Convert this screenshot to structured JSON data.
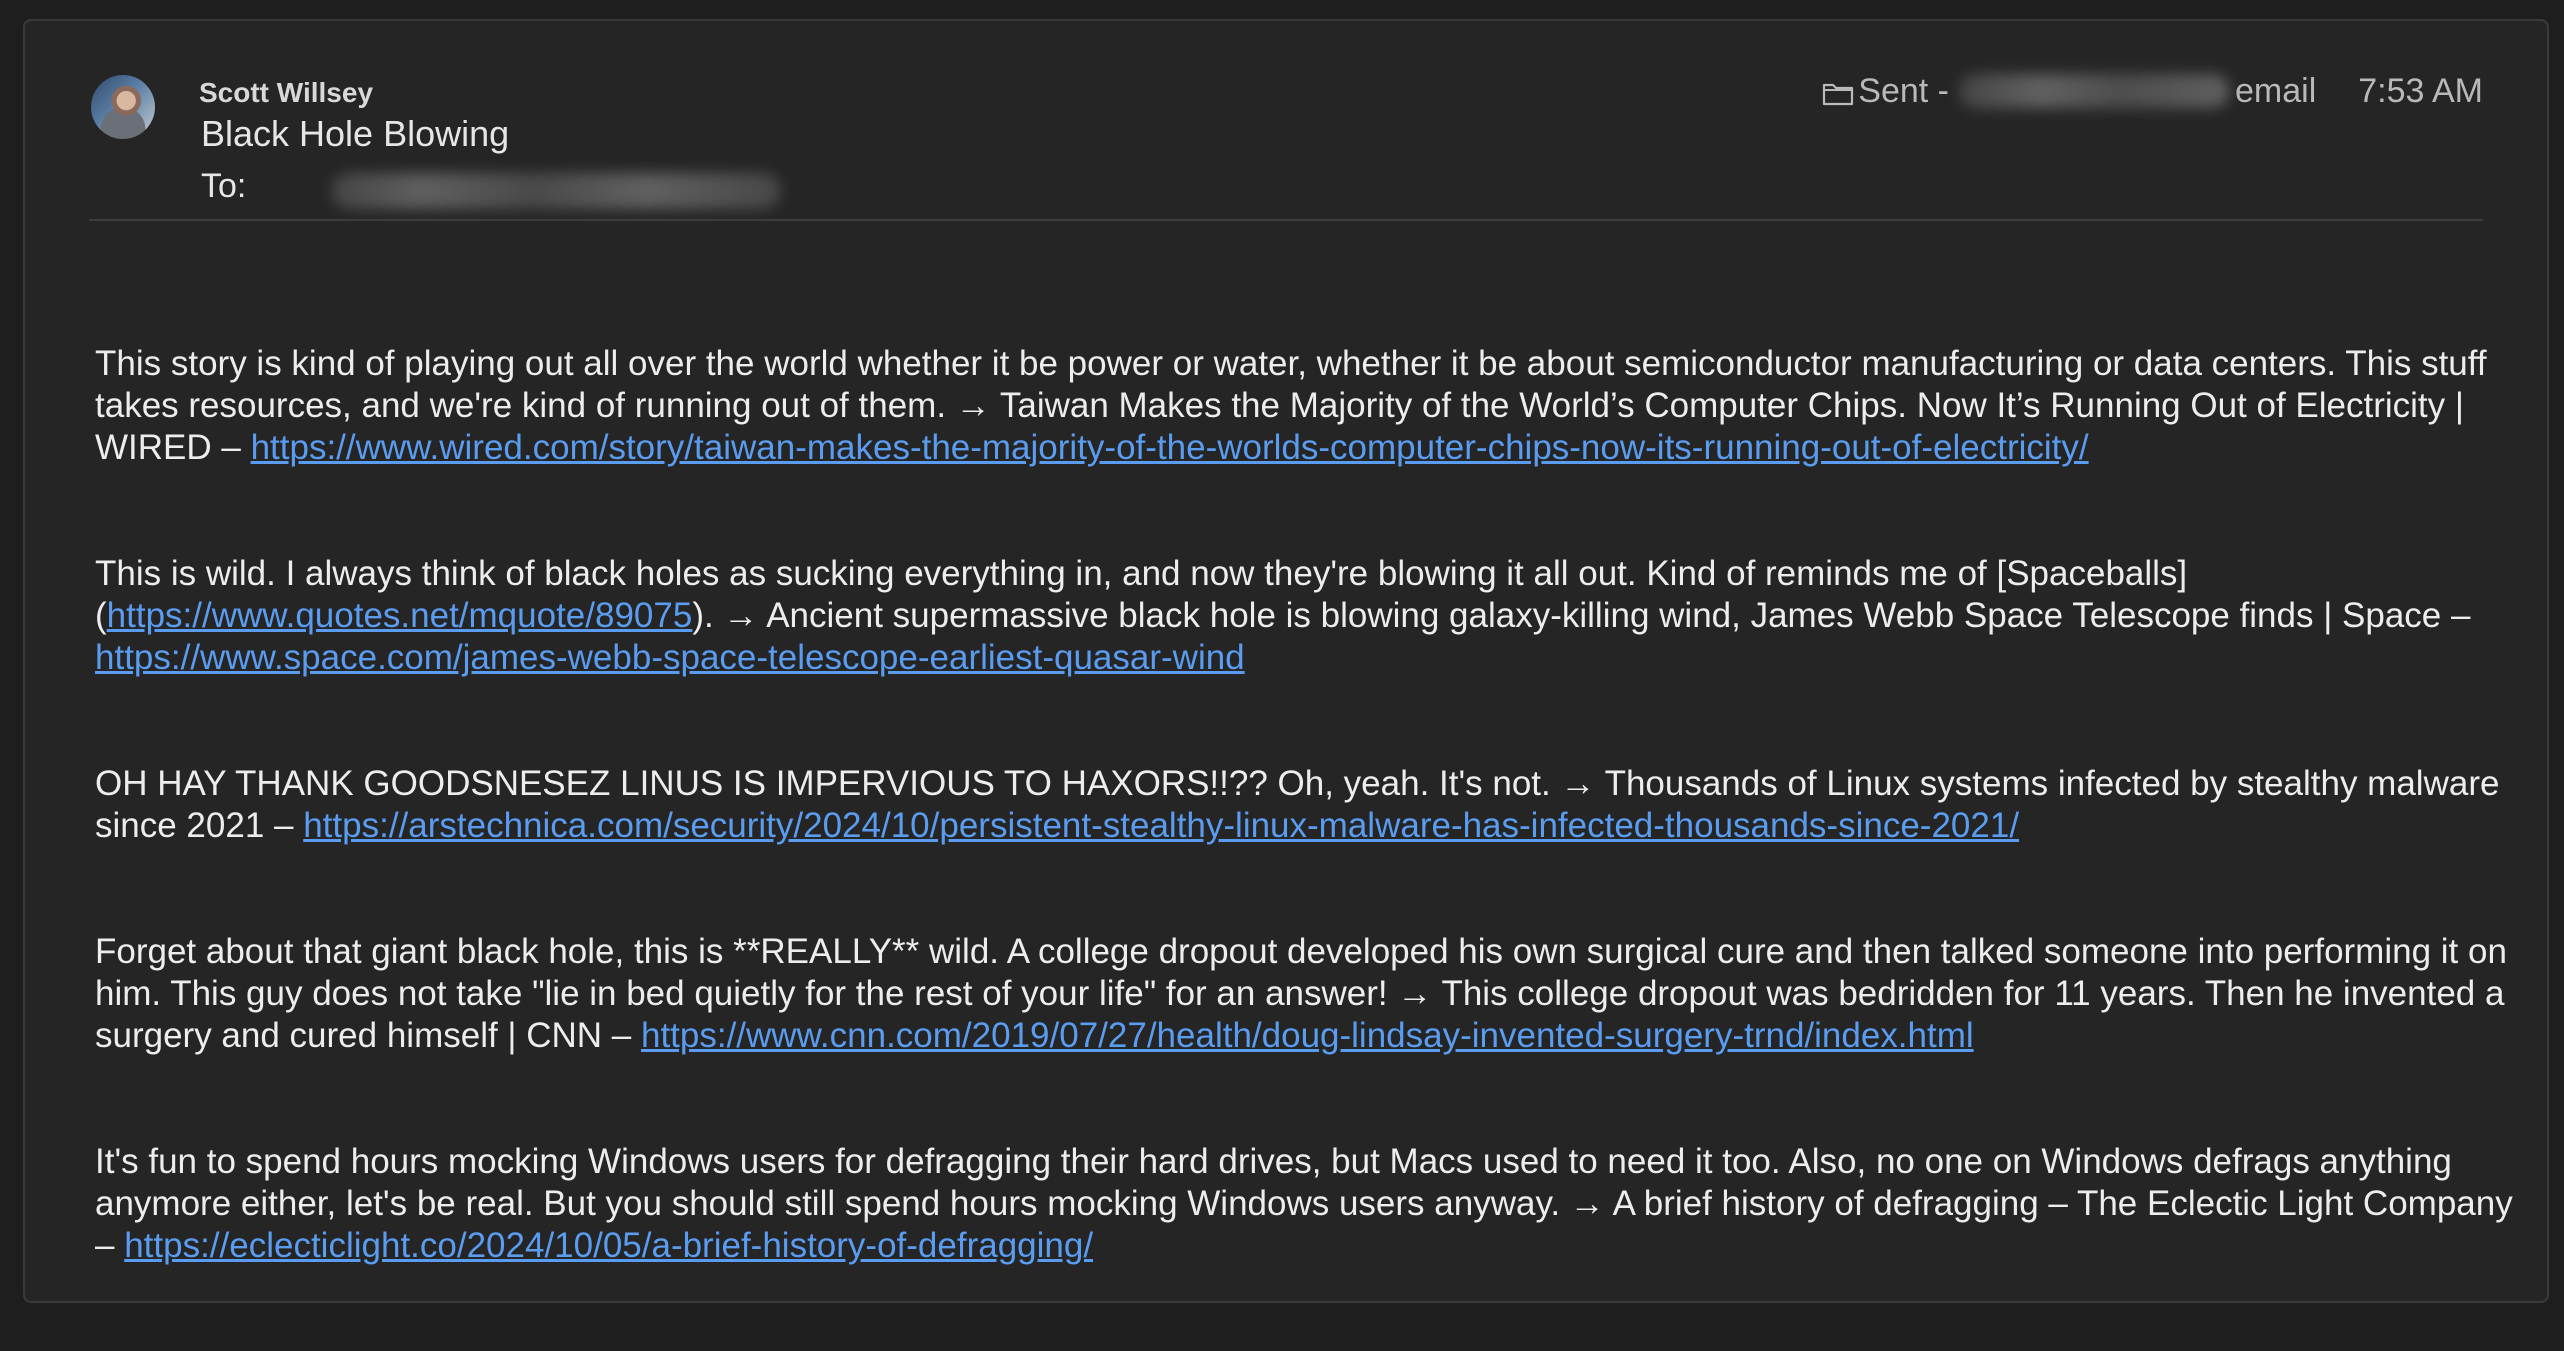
{
  "header": {
    "sender_name": "Scott Willsey",
    "subject": "Black Hole Blowing",
    "to_label": "To:",
    "sent_prefix": "Sent -",
    "sent_suffix": "email",
    "time": "7:53 AM"
  },
  "icons": {
    "avatar": "avatar",
    "folder": "folder-icon"
  },
  "colors": {
    "background": "#1e1e1e",
    "panel": "#252526",
    "text": "#ededed",
    "link": "#5a9cf0"
  },
  "paragraphs": [
    {
      "text": "This story is kind of playing out all over the world whether it be power or water, whether it be about semiconductor manufacturing or data centers. This stuff takes resources, and we're kind of running out of them. → Taiwan Makes the Majority of the World’s Computer Chips. Now It’s Running Out of Electricity | WIRED – ",
      "link": "https://www.wired.com/story/taiwan-makes-the-majority-of-the-worlds-computer-chips-now-its-running-out-of-electricity/"
    },
    {
      "pre": "This is wild. I always think of black holes as sucking everything in, and now they're blowing it all out. Kind of reminds me of [Spaceballs](",
      "inline_link": "https://www.quotes.net/mquote/89075",
      "text": "). → Ancient supermassive black hole is blowing galaxy-killing wind, James Webb Space Telescope finds | Space – ",
      "link": "https://www.space.com/james-webb-space-telescope-earliest-quasar-wind"
    },
    {
      "text": "OH HAY THANK GOODSNESEZ LINUS IS IMPERVIOUS TO HAXORS!!?? Oh, yeah. It's not. → Thousands of Linux systems infected by stealthy malware since 2021 – ",
      "link": "https://arstechnica.com/security/2024/10/persistent-stealthy-linux-malware-has-infected-thousands-since-2021/"
    },
    {
      "text": "Forget about that giant black hole, this is **REALLY** wild. A college dropout developed his own surgical cure and then talked someone into performing it on him. This guy does not take \"lie in bed quietly for the rest of your life\" for an answer! → This college dropout was bedridden for 11 years. Then he invented a surgery and cured himself | CNN – ",
      "link": "https://www.cnn.com/2019/07/27/health/doug-lindsay-invented-surgery-trnd/index.html"
    },
    {
      "text": "It's fun to spend hours mocking Windows users for defragging their hard drives, but Macs used to need it too. Also, no one on Windows defrags anything anymore either, let's be real. But you should still spend hours mocking Windows users anyway. → A brief history of defragging – The Eclectic Light Company – ",
      "link": "https://eclecticlight.co/2024/10/05/a-brief-history-of-defragging/"
    }
  ]
}
